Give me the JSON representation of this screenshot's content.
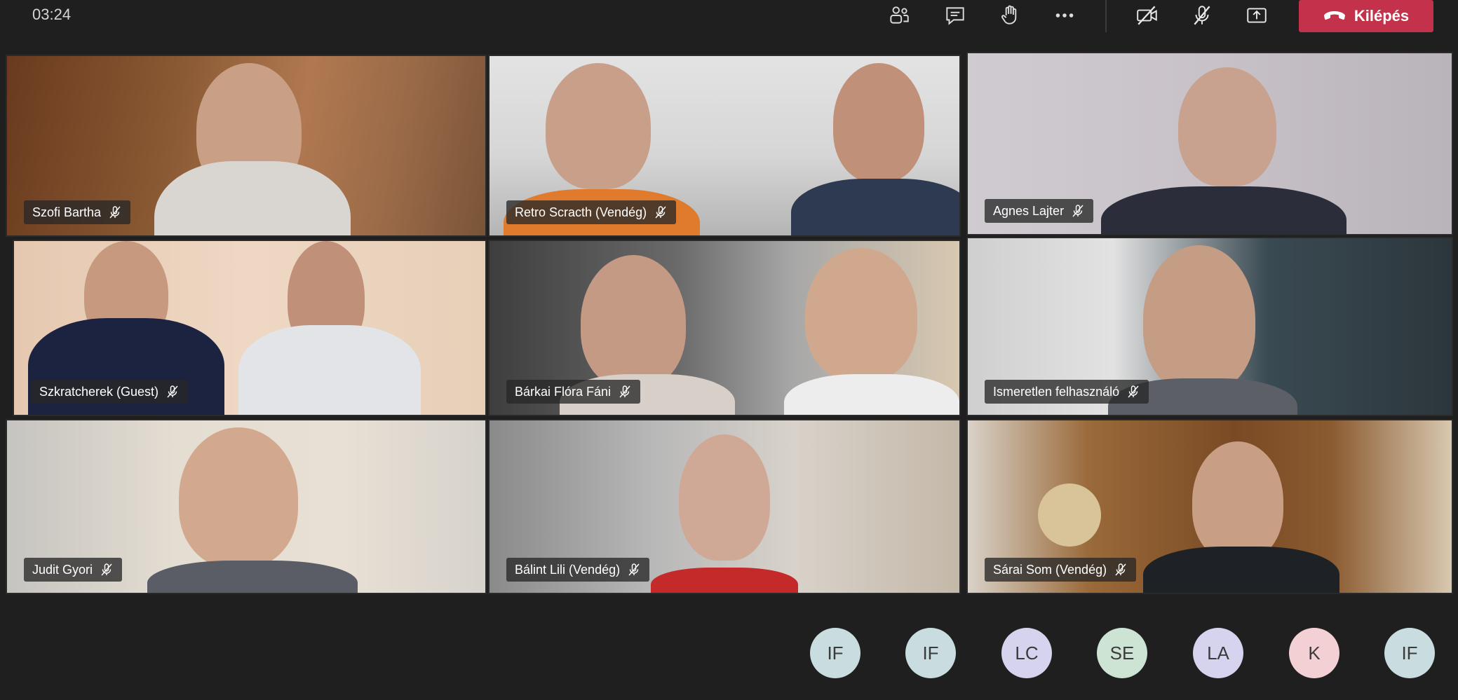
{
  "call": {
    "timer": "03:24",
    "leave_label": "Kilépés"
  },
  "toolbar": {
    "icons": [
      "participants-icon",
      "chat-icon",
      "raise-hand-icon",
      "more-options-icon",
      "camera-off-icon",
      "mic-off-icon",
      "share-screen-icon",
      "hang-up-icon"
    ]
  },
  "participants": [
    {
      "name": "Szofi Bartha",
      "muted": true
    },
    {
      "name": "Retro Scracth (Vendég)",
      "muted": true
    },
    {
      "name": "Agnes Lajter",
      "muted": true
    },
    {
      "name": "Szkratcherek (Guest)",
      "muted": true
    },
    {
      "name": "Bárkai Flóra Fáni",
      "muted": true
    },
    {
      "name": "Ismeretlen felhasználó",
      "muted": true
    },
    {
      "name": "Judit Gyori",
      "muted": true
    },
    {
      "name": "Bálint Lili (Vendég)",
      "muted": true
    },
    {
      "name": "Sárai Som (Vendég)",
      "muted": true
    }
  ],
  "overflow_avatars": [
    {
      "initials": "IF",
      "color": "#c9dde0"
    },
    {
      "initials": "IF",
      "color": "#c9dde0"
    },
    {
      "initials": "LC",
      "color": "#d6d3ef"
    },
    {
      "initials": "SE",
      "color": "#cde3d4"
    },
    {
      "initials": "LA",
      "color": "#d6d3ef"
    },
    {
      "initials": "K",
      "color": "#f3d0d4"
    },
    {
      "initials": "IF",
      "color": "#c9dde0"
    }
  ],
  "colors": {
    "background": "#1f1f1f",
    "leave_button": "#c4314b"
  }
}
